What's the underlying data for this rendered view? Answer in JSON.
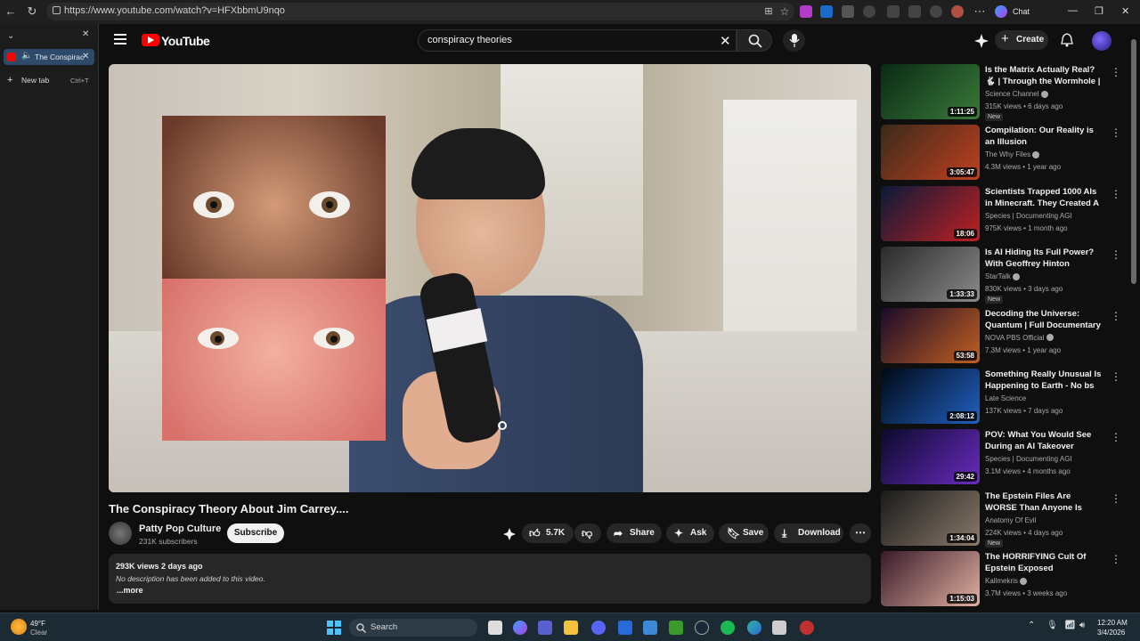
{
  "browser": {
    "url": "https://www.youtube.com/watch?v=HFXbbmU9nqo",
    "chat_label": "Chat",
    "tabs": [
      {
        "label": "The Conspirac",
        "active": true
      }
    ],
    "new_tab_label": "New tab",
    "new_tab_shortcut": "Ctrl+T"
  },
  "youtube": {
    "brand": "YouTube",
    "search_value": "conspiracy theories",
    "create_label": "Create"
  },
  "video": {
    "title": "The Conspiracy Theory About Jim Carrey....",
    "channel": "Patty Pop Culture",
    "subscribers": "231K subscribers",
    "subscribe_label": "Subscribe",
    "likes": "5.7K",
    "share_label": "Share",
    "ask_label": "Ask",
    "save_label": "Save",
    "download_label": "Download",
    "views_date": "293K views  2 days ago",
    "description": "No description has been added to this video.",
    "more_label": "...more"
  },
  "recommendations": [
    {
      "title": "Is the Matrix Actually Real? 🐇 | Through the Wormhole | ...",
      "channel": "Science Channel",
      "verified": true,
      "meta": "315K views • 6 days ago",
      "duration": "1:11:25",
      "new": true,
      "thumb_colors": [
        "#0a2a14",
        "#3a7a3a"
      ]
    },
    {
      "title": "Compilation: Our Reality is an Illusion",
      "channel": "The Why Files",
      "verified": true,
      "meta": "4.3M views • 1 year ago",
      "duration": "3:05:47",
      "new": false,
      "thumb_colors": [
        "#3a2a1a",
        "#c04020"
      ]
    },
    {
      "title": "Scientists Trapped 1000 AIs in Minecraft. They Created A ...",
      "channel": "Species | Documenting AGI",
      "verified": false,
      "meta": "975K views • 1 month ago",
      "duration": "18:06",
      "new": false,
      "thumb_colors": [
        "#0a1a3a",
        "#c02020"
      ]
    },
    {
      "title": "Is AI Hiding Its Full Power? With Geoffrey Hinton",
      "channel": "StarTalk",
      "verified": true,
      "meta": "830K views • 3 days ago",
      "duration": "1:33:33",
      "new": true,
      "thumb_colors": [
        "#2a2a2a",
        "#8a8a8a"
      ]
    },
    {
      "title": "Decoding the Universe: Quantum | Full Documentary | ...",
      "channel": "NOVA PBS Official",
      "verified": true,
      "meta": "7.3M views • 1 year ago",
      "duration": "53:58",
      "new": false,
      "thumb_colors": [
        "#1a0a2a",
        "#c06020"
      ]
    },
    {
      "title": "Something Really Unusual Is Happening to Earth - No bs",
      "channel": "Late Science",
      "verified": false,
      "meta": "137K views • 7 days ago",
      "duration": "2:08:12",
      "new": false,
      "thumb_colors": [
        "#000814",
        "#2060c0"
      ]
    },
    {
      "title": "POV: What You Would See During an AI Takeover",
      "channel": "Species | Documenting AGI",
      "verified": false,
      "meta": "3.1M views • 4 months ago",
      "duration": "29:42",
      "new": false,
      "thumb_colors": [
        "#0a0a2a",
        "#6a2ac0"
      ]
    },
    {
      "title": "The Epstein Files Are WORSE Than Anyone Is Telling You",
      "channel": "Anatomy Of Evil",
      "verified": false,
      "meta": "224K views • 4 days ago",
      "duration": "1:34:04",
      "new": true,
      "thumb_colors": [
        "#1a1a1a",
        "#8a7a6a"
      ]
    },
    {
      "title": "The HORRIFYING Cult Of Epstein Exposed",
      "channel": "Kallmekris",
      "verified": true,
      "meta": "3.7M views • 3 weeks ago",
      "duration": "1:15:03",
      "new": false,
      "thumb_colors": [
        "#3a1a2a",
        "#e0b0a0"
      ]
    }
  ],
  "taskbar": {
    "temp": "49°F",
    "condition": "Clear",
    "search_label": "Search",
    "time": "12:20 AM",
    "date": "3/4/2026"
  }
}
